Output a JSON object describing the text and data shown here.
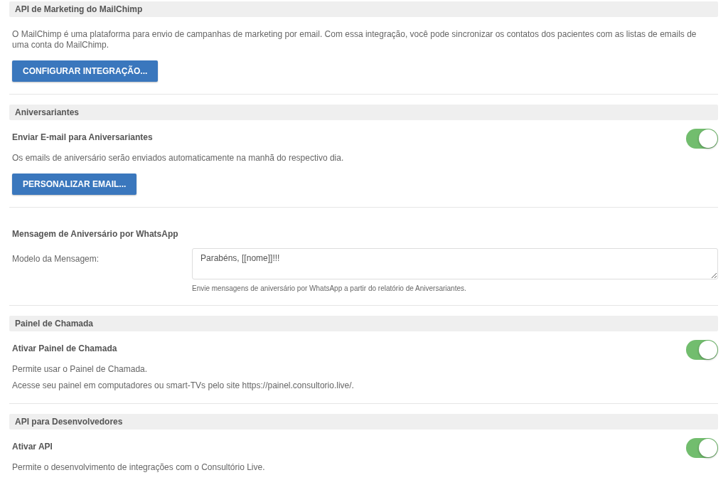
{
  "sections": [
    {
      "title": "API de Marketing do MailChimp",
      "blocks": [
        {
          "kind": "text",
          "text": "O MailChimp é uma plataforma para envio de campanhas de marketing por email. Com essa integração, você pode sincronizar os contatos dos pacientes com as listas de emails de uma conta do MailChimp."
        },
        {
          "kind": "button",
          "label": "CONFIGURAR INTEGRAÇÃO..."
        }
      ]
    },
    {
      "title": "Aniversariantes",
      "blocks": [
        {
          "kind": "toggle",
          "label": "Enviar E-mail para Aniversariantes",
          "on": true
        },
        {
          "kind": "text",
          "text": "Os emails de aniversário serão enviados automaticamente na manhã do respectivo dia."
        },
        {
          "kind": "button",
          "label": "PERSONALIZAR EMAIL..."
        }
      ]
    },
    {
      "blocks": [
        {
          "kind": "subheading",
          "text": "Mensagem de Aniversário por WhatsApp"
        },
        {
          "kind": "textarea",
          "label": "Modelo da Mensagem:",
          "value": "Parabéns, [[nome]]!!!",
          "note": "Envie mensagens de aniversário por WhatsApp a partir do relatório de Aniversariantes."
        }
      ]
    },
    {
      "title": "Painel de Chamada",
      "blocks": [
        {
          "kind": "toggle",
          "label": "Ativar Painel de Chamada",
          "on": true
        },
        {
          "kind": "text",
          "text": "Permite usar o Painel de Chamada."
        },
        {
          "kind": "text",
          "text": "Acesse seu painel em computadores ou smart-TVs pelo site https://painel.consultorio.live/."
        }
      ]
    },
    {
      "title": "API para Desenvolvedores",
      "blocks": [
        {
          "kind": "toggle",
          "label": "Ativar API",
          "on": true
        },
        {
          "kind": "text",
          "text": "Permite o desenvolvimento de integrações com o Consultório Live."
        }
      ]
    }
  ]
}
